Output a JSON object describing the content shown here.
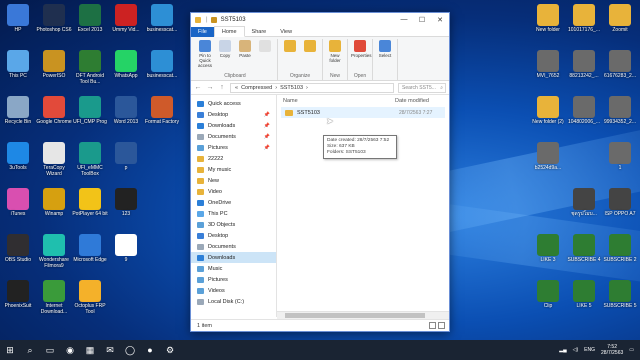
{
  "desktop": {
    "left_icons": [
      {
        "label": "HP",
        "color": "#3a78d8",
        "x": 0,
        "y": 0
      },
      {
        "label": "Photoshop CS6",
        "color": "#1f2f4f",
        "x": 1,
        "y": 0
      },
      {
        "label": "Excel 2013",
        "color": "#1d7044",
        "x": 2,
        "y": 0
      },
      {
        "label": "Ummy Vid...",
        "color": "#cc2222",
        "x": 3,
        "y": 0
      },
      {
        "label": "businesscat...",
        "color": "#2d8fd5",
        "x": 4,
        "y": 0
      },
      {
        "label": "This PC",
        "color": "#5aa7e8",
        "x": 0,
        "y": 1
      },
      {
        "label": "PowerISO",
        "color": "#c99321",
        "x": 1,
        "y": 1
      },
      {
        "label": "DFT Android Tool Bu...",
        "color": "#2e7d32",
        "x": 2,
        "y": 1
      },
      {
        "label": "WhatsApp",
        "color": "#25d366",
        "x": 3,
        "y": 1
      },
      {
        "label": "businesscat...",
        "color": "#2d8fd5",
        "x": 4,
        "y": 1
      },
      {
        "label": "Recycle Bin",
        "color": "#8aa7c6",
        "x": 0,
        "y": 2
      },
      {
        "label": "Google Chrome",
        "color": "#e24a3a",
        "x": 1,
        "y": 2
      },
      {
        "label": "UFI_CMP Prog",
        "color": "#1a9a8c",
        "x": 2,
        "y": 2
      },
      {
        "label": "Word 2013",
        "color": "#2b579a",
        "x": 3,
        "y": 2
      },
      {
        "label": "Format Factory",
        "color": "#cf5a2a",
        "x": 4,
        "y": 2
      },
      {
        "label": "3uTools",
        "color": "#1e88e5",
        "x": 0,
        "y": 3
      },
      {
        "label": "TeraCopy Wizard",
        "color": "#e6e6e6",
        "x": 1,
        "y": 3
      },
      {
        "label": "UFI_eMMC ToolBox",
        "color": "#1a9a8c",
        "x": 2,
        "y": 3
      },
      {
        "label": "p",
        "color": "#2b579a",
        "x": 3,
        "y": 3
      },
      {
        "label": "iTunes",
        "color": "#d94fb0",
        "x": 0,
        "y": 4
      },
      {
        "label": "Winamp",
        "color": "#d6a010",
        "x": 1,
        "y": 4
      },
      {
        "label": "PotPlayer 64 bit",
        "color": "#f2c318",
        "x": 2,
        "y": 4
      },
      {
        "label": "123",
        "color": "#222222",
        "x": 3,
        "y": 4
      },
      {
        "label": "OBS Studio",
        "color": "#302e31",
        "x": 0,
        "y": 5
      },
      {
        "label": "Wondershare Filmora9",
        "color": "#1fbfae",
        "x": 1,
        "y": 5
      },
      {
        "label": "Microsoft Edge",
        "color": "#2f7ad8",
        "x": 2,
        "y": 5
      },
      {
        "label": "9",
        "color": "#ffffff",
        "x": 3,
        "y": 5
      },
      {
        "label": "PhoenixSuit",
        "color": "#222222",
        "x": 0,
        "y": 6
      },
      {
        "label": "Internet Download...",
        "color": "#3a9b3a",
        "x": 1,
        "y": 6
      },
      {
        "label": "Octoplus FRP Tool",
        "color": "#f4b12a",
        "x": 2,
        "y": 6
      }
    ],
    "right_icons": [
      {
        "label": "New folder",
        "color": "#e8b33a",
        "x": 0,
        "y": 0
      },
      {
        "label": "101017176_...",
        "color": "#e8b33a",
        "x": 1,
        "y": 0
      },
      {
        "label": "Zoomit",
        "color": "#e8b33a",
        "x": 2,
        "y": 0
      },
      {
        "label": "MVI_7652",
        "color": "#6a6a6a",
        "x": 0,
        "y": 1
      },
      {
        "label": "88213242_...",
        "color": "#6a6a6a",
        "x": 1,
        "y": 1
      },
      {
        "label": "61676283_2...",
        "color": "#6a6a6a",
        "x": 2,
        "y": 1
      },
      {
        "label": "New folder (2)",
        "color": "#e8b33a",
        "x": 0,
        "y": 2
      },
      {
        "label": "104802006_...",
        "color": "#6a6a6a",
        "x": 1,
        "y": 2
      },
      {
        "label": "99934352_2...",
        "color": "#6a6a6a",
        "x": 2,
        "y": 2
      },
      {
        "label": "b2524d9a...",
        "color": "#6a6a6a",
        "x": 0,
        "y": 3
      },
      {
        "label": "1",
        "color": "#6a6a6a",
        "x": 2,
        "y": 3
      },
      {
        "label": "ชุดรูปโมบ...",
        "color": "#444444",
        "x": 1,
        "y": 4
      },
      {
        "label": "ISP OPPO A7",
        "color": "#444444",
        "x": 2,
        "y": 4
      },
      {
        "label": "LIKE 3",
        "color": "#2e7d32",
        "x": 0,
        "y": 5
      },
      {
        "label": "SUBSCRIBE 4",
        "color": "#2e7d32",
        "x": 1,
        "y": 5
      },
      {
        "label": "SUBSCRIBE 2",
        "color": "#2e7d32",
        "x": 2,
        "y": 5
      },
      {
        "label": "Clip",
        "color": "#2e7d32",
        "x": 0,
        "y": 6
      },
      {
        "label": "LIKE 5",
        "color": "#2e7d32",
        "x": 1,
        "y": 6
      },
      {
        "label": "SUBSCRIBE 5",
        "color": "#2e7d32",
        "x": 2,
        "y": 6
      }
    ]
  },
  "explorer": {
    "title": "SST5103",
    "controls": [
      "—",
      "☐",
      "✕"
    ],
    "tabs": [
      "File",
      "Home",
      "Share",
      "View"
    ],
    "ribbon": {
      "clipboard": {
        "name": "Clipboard",
        "buttons": [
          "Pin to Quick access",
          "Copy",
          "Paste"
        ]
      },
      "organize": {
        "name": "Organize",
        "buttons": [
          "Move to",
          "Copy to"
        ]
      },
      "new": {
        "name": "New",
        "buttons": [
          "New folder"
        ]
      },
      "open": {
        "name": "Open",
        "buttons": [
          "Properties"
        ]
      },
      "select": {
        "buttons": [
          "Select"
        ]
      }
    },
    "address": {
      "parts": [
        "«",
        "Compressed",
        "›",
        "SST5103",
        "›"
      ],
      "search_placeholder": "Search SST5..."
    },
    "nav": [
      {
        "label": "Quick access",
        "color": "#2b7fd8",
        "pin": false,
        "sel": false
      },
      {
        "label": "Desktop",
        "color": "#3a7fd8",
        "pin": true,
        "sel": false
      },
      {
        "label": "Downloads",
        "color": "#2b7fd8",
        "pin": true,
        "sel": false
      },
      {
        "label": "Documents",
        "color": "#9aa8b8",
        "pin": true,
        "sel": false
      },
      {
        "label": "Pictures",
        "color": "#5aa0d8",
        "pin": true,
        "sel": false
      },
      {
        "label": "22222",
        "color": "#e8b33a",
        "pin": false,
        "sel": false
      },
      {
        "label": "My music",
        "color": "#e8b33a",
        "pin": false,
        "sel": false
      },
      {
        "label": "New",
        "color": "#e8b33a",
        "pin": false,
        "sel": false
      },
      {
        "label": "Video",
        "color": "#e8b33a",
        "pin": false,
        "sel": false
      },
      {
        "label": "OneDrive",
        "color": "#2b7fd8",
        "pin": false,
        "sel": false
      },
      {
        "label": "This PC",
        "color": "#5aa7e8",
        "pin": false,
        "sel": false
      },
      {
        "label": "3D Objects",
        "color": "#5aa0d8",
        "pin": false,
        "sel": false
      },
      {
        "label": "Desktop",
        "color": "#3a7fd8",
        "pin": false,
        "sel": false
      },
      {
        "label": "Documents",
        "color": "#9aa8b8",
        "pin": false,
        "sel": false
      },
      {
        "label": "Downloads",
        "color": "#2b7fd8",
        "pin": false,
        "sel": true
      },
      {
        "label": "Music",
        "color": "#5aa0d8",
        "pin": false,
        "sel": false
      },
      {
        "label": "Pictures",
        "color": "#5aa0d8",
        "pin": false,
        "sel": false
      },
      {
        "label": "Videos",
        "color": "#5aa0d8",
        "pin": false,
        "sel": false
      },
      {
        "label": "Local Disk (C:)",
        "color": "#9aa8b8",
        "pin": false,
        "sel": false
      }
    ],
    "columns": {
      "name": "Name",
      "date": "Date modified"
    },
    "files": [
      {
        "name": "SST5103",
        "date": "28/7/2563 7:27"
      }
    ],
    "tooltip": [
      "Date created: 28/7/2563 7:52",
      "Size: 637 KB",
      "Folders: SST5103"
    ],
    "status": "1 item"
  },
  "taskbar": {
    "icons": [
      "⊞",
      "⌕",
      "▭",
      "◉",
      "▦",
      "✉",
      "◯",
      "●",
      "⚙"
    ],
    "tray": {
      "lang": "ENG",
      "time": "7:52",
      "date": "28/7/2563"
    }
  }
}
